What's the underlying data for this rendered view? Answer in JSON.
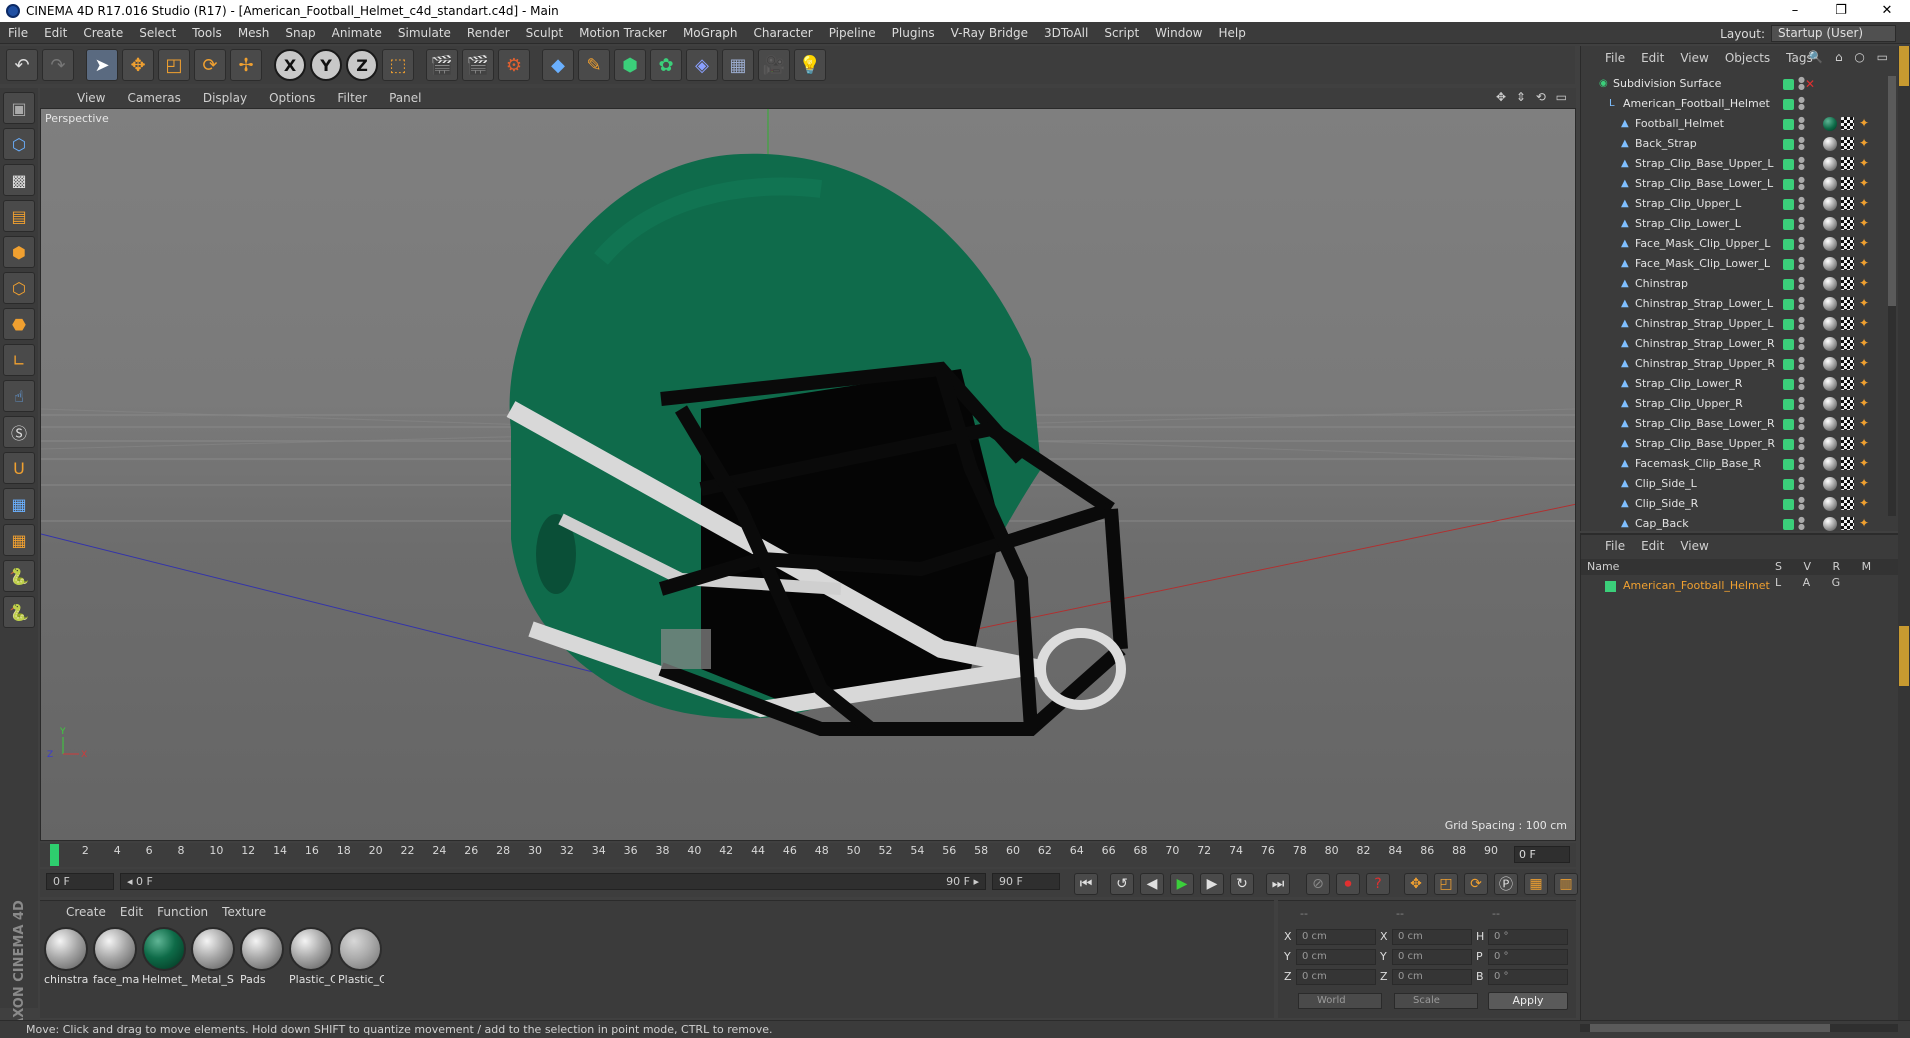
{
  "window": {
    "title": "CINEMA 4D R17.016 Studio (R17) - [American_Football_Helmet_c4d_standart.c4d] - Main",
    "controls": [
      "–",
      "❐",
      "✕"
    ]
  },
  "menubar": {
    "items": [
      "File",
      "Edit",
      "Create",
      "Select",
      "Tools",
      "Mesh",
      "Snap",
      "Animate",
      "Simulate",
      "Render",
      "Sculpt",
      "Motion Tracker",
      "MoGraph",
      "Character",
      "Pipeline",
      "Plugins",
      "V-Ray Bridge",
      "3DToAll",
      "Script",
      "Window",
      "Help"
    ],
    "layout_label": "Layout:",
    "layout_value": "Startup (User)"
  },
  "toolbar": {
    "undo_icon": "undo-icon",
    "axis_x": "X",
    "axis_y": "Y",
    "axis_z": "Z"
  },
  "viewport": {
    "menu": [
      "View",
      "Cameras",
      "Display",
      "Options",
      "Filter",
      "Panel"
    ],
    "camera_label": "Perspective",
    "grid_spacing": "Grid Spacing : 100 cm",
    "nav_icons": "✥ ⇕ ⟲ ▭"
  },
  "timeline": {
    "ticks": [
      "0",
      "2",
      "4",
      "6",
      "8",
      "10",
      "12",
      "14",
      "16",
      "18",
      "20",
      "22",
      "24",
      "26",
      "28",
      "30",
      "32",
      "34",
      "36",
      "38",
      "40",
      "42",
      "44",
      "46",
      "48",
      "50",
      "52",
      "54",
      "56",
      "58",
      "60",
      "62",
      "64",
      "66",
      "68",
      "70",
      "72",
      "74",
      "76",
      "78",
      "80",
      "82",
      "84",
      "86",
      "88",
      "90"
    ],
    "current_frame": "0 F"
  },
  "transport": {
    "start_frame": "0 F",
    "range_start": "◂ 0 F",
    "range_end": "90 F ▸",
    "end_frame": "90 F"
  },
  "materials": {
    "menu": [
      "Create",
      "Edit",
      "Function",
      "Texture"
    ],
    "items": [
      {
        "name": "chinstra",
        "kind": "grey"
      },
      {
        "name": "face_ma",
        "kind": "grey"
      },
      {
        "name": "Helmet_",
        "kind": "green"
      },
      {
        "name": "Metal_S",
        "kind": "grey"
      },
      {
        "name": "Pads",
        "kind": "grey"
      },
      {
        "name": "Plastic_C",
        "kind": "grey"
      },
      {
        "name": "Plastic_C",
        "kind": "clear"
      }
    ],
    "brand": "MAXON CINEMA 4D"
  },
  "coordinates": {
    "header": [
      "--",
      "--",
      "--"
    ],
    "rows": [
      {
        "a": "X",
        "av": "0 cm",
        "b": "X",
        "bv": "0 cm",
        "c": "H",
        "cv": "0 °"
      },
      {
        "a": "Y",
        "av": "0 cm",
        "b": "Y",
        "bv": "0 cm",
        "c": "P",
        "cv": "0 °"
      },
      {
        "a": "Z",
        "av": "0 cm",
        "b": "Z",
        "bv": "0 cm",
        "c": "B",
        "cv": "0 °"
      }
    ],
    "mode_world": "World",
    "mode_scale": "Scale",
    "apply": "Apply"
  },
  "status": {
    "text": "Move: Click and drag to move elements. Hold down SHIFT to quantize movement / add to the selection in point mode, CTRL to remove."
  },
  "object_manager": {
    "menu": [
      "File",
      "Edit",
      "View",
      "Objects",
      "Tags"
    ],
    "objects": [
      {
        "name": "Subdivision Surface",
        "level": 0,
        "tag": "none"
      },
      {
        "name": "American_Football_Helmet",
        "level": 1,
        "tag": "none"
      },
      {
        "name": "Football_Helmet",
        "level": 2,
        "tag": "green"
      },
      {
        "name": "Back_Strap",
        "level": 2,
        "tag": "grey"
      },
      {
        "name": "Strap_Clip_Base_Upper_L",
        "level": 2,
        "tag": "grey"
      },
      {
        "name": "Strap_Clip_Base_Lower_L",
        "level": 2,
        "tag": "grey"
      },
      {
        "name": "Strap_Clip_Upper_L",
        "level": 2,
        "tag": "grey"
      },
      {
        "name": "Strap_Clip_Lower_L",
        "level": 2,
        "tag": "grey"
      },
      {
        "name": "Face_Mask_Clip_Upper_L",
        "level": 2,
        "tag": "grey"
      },
      {
        "name": "Face_Mask_Clip_Lower_L",
        "level": 2,
        "tag": "grey"
      },
      {
        "name": "Chinstrap",
        "level": 2,
        "tag": "grey"
      },
      {
        "name": "Chinstrap_Strap_Lower_L",
        "level": 2,
        "tag": "grey"
      },
      {
        "name": "Chinstrap_Strap_Upper_L",
        "level": 2,
        "tag": "grey"
      },
      {
        "name": "Chinstrap_Strap_Lower_R",
        "level": 2,
        "tag": "grey"
      },
      {
        "name": "Chinstrap_Strap_Upper_R",
        "level": 2,
        "tag": "grey"
      },
      {
        "name": "Strap_Clip_Lower_R",
        "level": 2,
        "tag": "grey"
      },
      {
        "name": "Strap_Clip_Upper_R",
        "level": 2,
        "tag": "grey"
      },
      {
        "name": "Strap_Clip_Base_Lower_R",
        "level": 2,
        "tag": "grey"
      },
      {
        "name": "Strap_Clip_Base_Upper_R",
        "level": 2,
        "tag": "grey"
      },
      {
        "name": "Facemask_Clip_Base_R",
        "level": 2,
        "tag": "grey"
      },
      {
        "name": "Clip_Side_L",
        "level": 2,
        "tag": "grey"
      },
      {
        "name": "Clip_Side_R",
        "level": 2,
        "tag": "grey"
      },
      {
        "name": "Cap_Back",
        "level": 2,
        "tag": "grey"
      }
    ]
  },
  "layer_manager": {
    "menu": [
      "File",
      "Edit",
      "View"
    ],
    "col_name": "Name",
    "cols": "S V R M L A G",
    "layer_name": "American_Football_Helmet"
  },
  "colors": {
    "helmet_green": "#0f6b4b",
    "visibility_green": "#3bcf7a",
    "accent_orange": "#f0a030"
  }
}
